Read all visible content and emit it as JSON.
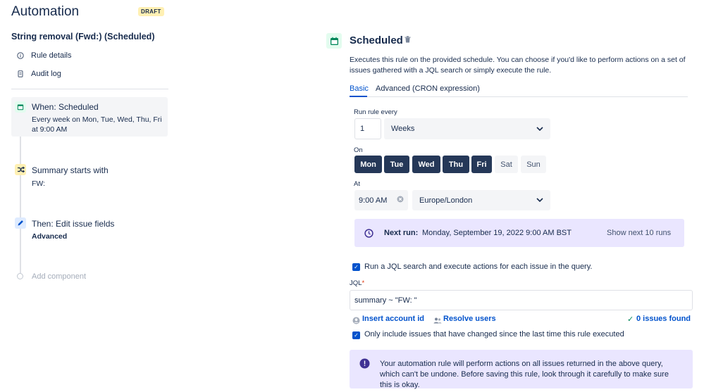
{
  "header": {
    "title": "Automation",
    "badge": "DRAFT"
  },
  "rule": {
    "name": "String removal (Fwd:) (Scheduled)",
    "nav": [
      {
        "label": "Rule details",
        "icon": "info-icon"
      },
      {
        "label": "Audit log",
        "icon": "document-icon"
      }
    ]
  },
  "steps": {
    "trigger": {
      "title": "When: Scheduled",
      "line1": "Every week on Mon, Tue, Wed, Thu, Fri",
      "line2": "at 9:00 AM"
    },
    "condition": {
      "title": "Summary starts with",
      "sub": "FW:"
    },
    "action": {
      "title": "Then: Edit issue fields",
      "sub": "Advanced"
    },
    "add": "Add component"
  },
  "panel": {
    "title": "Scheduled",
    "description": "Executes this rule on the provided schedule. You can choose if you'd like to perform actions on a set of issues gathered with a JQL search or simply execute the rule.",
    "tabs": [
      "Basic",
      "Advanced (CRON expression)"
    ],
    "run_every_label": "Run rule every",
    "run_every_value": "1",
    "period": "Weeks",
    "on_label": "On",
    "days": [
      {
        "label": "Mon",
        "selected": true
      },
      {
        "label": "Tue",
        "selected": true
      },
      {
        "label": "Wed",
        "selected": true
      },
      {
        "label": "Thu",
        "selected": true
      },
      {
        "label": "Fri",
        "selected": true
      },
      {
        "label": "Sat",
        "selected": false
      },
      {
        "label": "Sun",
        "selected": false
      }
    ],
    "at_label": "At",
    "time": "9:00 AM",
    "timezone": "Europe/London",
    "next_run_label": "Next run:",
    "next_run_value": "Monday, September 19, 2022 9:00 AM BST",
    "show_next": "Show next 10 runs",
    "jql_check": "Run a JQL search and execute actions for each issue in the query.",
    "jql_label": "JQL",
    "jql_value": "summary ~ \"FW: \"",
    "insert_account": "Insert account id",
    "resolve_users": "Resolve users",
    "issues_found": "0 issues found",
    "only_include": "Only include issues that have changed since the last time this rule executed",
    "warning": "Your automation rule will perform actions on all issues returned in the above query, which can't be undone. Before saving this rule, look through it carefully to make sure this is okay."
  },
  "colors": {
    "primary": "#0052cc",
    "day_selected": "#253858",
    "info_bg": "#eae6ff",
    "warning_icon": "#403294"
  }
}
